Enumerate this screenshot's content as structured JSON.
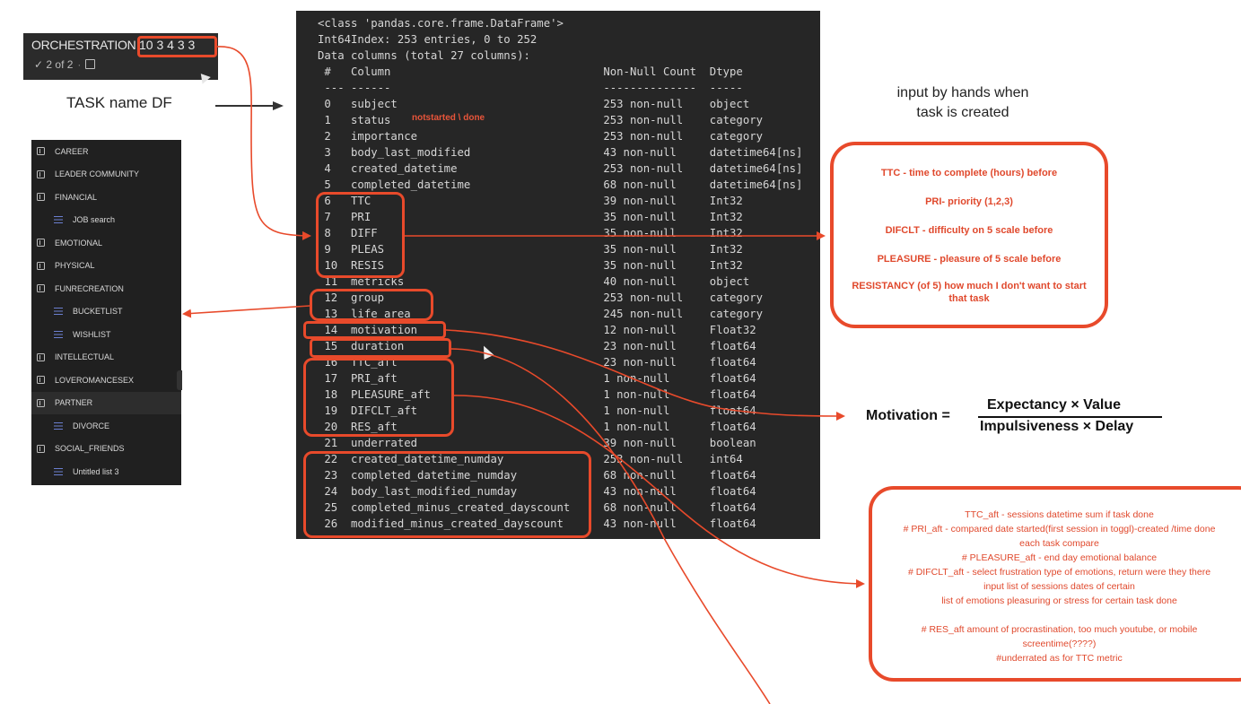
{
  "orchestration": {
    "title": "ORCHESTRATION",
    "numbers": "10 3 4 3 3",
    "progress": "✓ 2 of 2",
    "note_icon": "note-icon"
  },
  "task_label": "TASK name DF",
  "sidebar": {
    "items": [
      {
        "type": "group",
        "label": "CAREER"
      },
      {
        "type": "group",
        "label": "LEADER COMMUNITY"
      },
      {
        "type": "group",
        "label": "FINANCIAL"
      },
      {
        "type": "list",
        "label": "JOB search"
      },
      {
        "type": "group",
        "label": "EMOTIONAL"
      },
      {
        "type": "group",
        "label": "PHYSICAL"
      },
      {
        "type": "group",
        "label": "FUNRECREATION"
      },
      {
        "type": "list",
        "label": "BUCKETLIST"
      },
      {
        "type": "list",
        "label": "WISHLIST"
      },
      {
        "type": "group",
        "label": "INTELLECTUAL"
      },
      {
        "type": "group",
        "label": "LOVEROMANCESEX"
      },
      {
        "type": "group",
        "label": "PARTNER",
        "selected": true
      },
      {
        "type": "list",
        "label": "DIVORCE"
      },
      {
        "type": "group",
        "label": "SOCIAL_FRIENDS"
      },
      {
        "type": "list",
        "label": "Untitled list 3"
      }
    ]
  },
  "terminal": {
    "header": [
      "<class 'pandas.core.frame.DataFrame'>",
      "Int64Index: 253 entries, 0 to 252",
      "Data columns (total 27 columns):"
    ],
    "col_header": {
      "idx": "#",
      "column": "Column",
      "count": "Non-Null Count",
      "dtype": "Dtype"
    },
    "separator": {
      "idx": "---",
      "column": "------",
      "count": "--------------",
      "dtype": "-----"
    },
    "rows": [
      {
        "idx": "0",
        "column": "subject",
        "count": "253 non-null",
        "dtype": "object"
      },
      {
        "idx": "1",
        "column": "status",
        "count": "253 non-null",
        "dtype": "category"
      },
      {
        "idx": "2",
        "column": "importance",
        "count": "253 non-null",
        "dtype": "category"
      },
      {
        "idx": "3",
        "column": "body_last_modified",
        "count": "43 non-null",
        "dtype": "datetime64[ns]"
      },
      {
        "idx": "4",
        "column": "created_datetime",
        "count": "253 non-null",
        "dtype": "datetime64[ns]"
      },
      {
        "idx": "5",
        "column": "completed_datetime",
        "count": "68 non-null",
        "dtype": "datetime64[ns]"
      },
      {
        "idx": "6",
        "column": "TTC",
        "count": "39 non-null",
        "dtype": "Int32"
      },
      {
        "idx": "7",
        "column": "PRI",
        "count": "35 non-null",
        "dtype": "Int32"
      },
      {
        "idx": "8",
        "column": "DIFF",
        "count": "35 non-null",
        "dtype": "Int32"
      },
      {
        "idx": "9",
        "column": "PLEAS",
        "count": "35 non-null",
        "dtype": "Int32"
      },
      {
        "idx": "10",
        "column": "RESIS",
        "count": "35 non-null",
        "dtype": "Int32"
      },
      {
        "idx": "11",
        "column": "metricks",
        "count": "40 non-null",
        "dtype": "object"
      },
      {
        "idx": "12",
        "column": "group",
        "count": "253 non-null",
        "dtype": "category"
      },
      {
        "idx": "13",
        "column": "life_area",
        "count": "245 non-null",
        "dtype": "category"
      },
      {
        "idx": "14",
        "column": "motivation",
        "count": "12 non-null",
        "dtype": "Float32"
      },
      {
        "idx": "15",
        "column": "duration",
        "count": "23 non-null",
        "dtype": "float64"
      },
      {
        "idx": "16",
        "column": "TTC_aft",
        "count": "23 non-null",
        "dtype": "float64"
      },
      {
        "idx": "17",
        "column": "PRI_aft",
        "count": "1 non-null",
        "dtype": "float64"
      },
      {
        "idx": "18",
        "column": "PLEASURE_aft",
        "count": "1 non-null",
        "dtype": "float64"
      },
      {
        "idx": "19",
        "column": "DIFCLT_aft",
        "count": "1 non-null",
        "dtype": "float64"
      },
      {
        "idx": "20",
        "column": "RES_aft",
        "count": "1 non-null",
        "dtype": "float64"
      },
      {
        "idx": "21",
        "column": "underrated",
        "count": "39 non-null",
        "dtype": "boolean"
      },
      {
        "idx": "22",
        "column": "created_datetime_numday",
        "count": "253 non-null",
        "dtype": "int64"
      },
      {
        "idx": "23",
        "column": "completed_datetime_numday",
        "count": "68 non-null",
        "dtype": "float64"
      },
      {
        "idx": "24",
        "column": "body_last_modified_numday",
        "count": "43 non-null",
        "dtype": "float64"
      },
      {
        "idx": "25",
        "column": "completed_minus_created_dayscount",
        "count": "68 non-null",
        "dtype": "float64"
      },
      {
        "idx": "26",
        "column": "modified_minus_created_dayscount",
        "count": "43 non-null",
        "dtype": "float64"
      }
    ],
    "status_annotation": "notstarted \\ done"
  },
  "annotations": {
    "input_caption": [
      "input by hands when",
      "task is created"
    ],
    "before_box": [
      "TTC -  time to complete (hours) before",
      "PRI- priority (1,2,3)",
      "DIFCLT - difficulty on 5 scale before",
      "PLEASURE - pleasure of 5 scale before",
      "RESISTANCY (of 5) how much I don't want to start",
      "that task"
    ],
    "formula": {
      "lhs": "Motivation =",
      "numerator": "Expectancy × Value",
      "denominator": "Impulsiveness × Delay"
    },
    "after_box": [
      "TTC_aft - sessions datetime sum if task done",
      "# PRI_aft - compared date started(first session in toggl)-created /time done",
      "each task compare",
      "# PLEASURE_aft - end day emotional balance",
      "# DIFCLT_aft - select frustration type of emotions, return were they there",
      "input list of sessions dates of certain",
      "list of emotions pleasuring or stress  for certain task done",
      "",
      "# RES_aft amount of procrastination, too much youtube, or mobile",
      "screentime(????)",
      "#underrated as for TTC metric"
    ]
  },
  "colors": {
    "accent": "#e84a2b",
    "terminal_bg": "#262626",
    "sidebar_bg": "#202020",
    "list_icon": "#6b7fd0"
  }
}
